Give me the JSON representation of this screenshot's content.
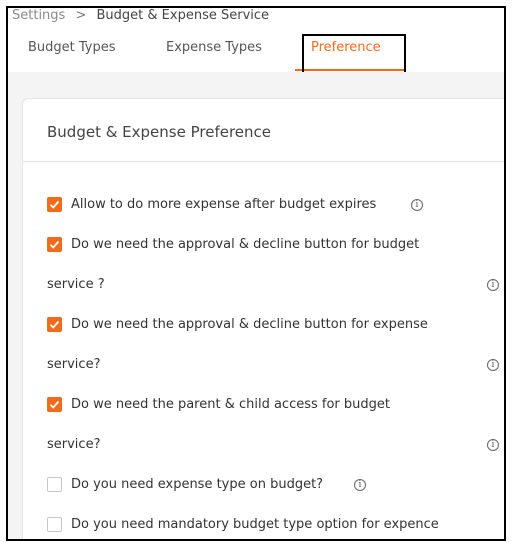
{
  "breadcrumb": {
    "root": "Settings",
    "separator": ">",
    "current": "Budget & Expense Service"
  },
  "tabs": [
    {
      "label": "Budget Types",
      "active": false
    },
    {
      "label": "Expense Types",
      "active": false
    },
    {
      "label": "Preference",
      "active": true
    }
  ],
  "card": {
    "title": "Budget & Expense Preference"
  },
  "options": [
    {
      "line1": "Allow to do more expense after budget expires",
      "line2": "",
      "checked": true
    },
    {
      "line1": "Do we need the approval & decline button for budget",
      "line2": "service ?",
      "checked": true
    },
    {
      "line1": "Do we need the approval & decline button for expense",
      "line2": "service?",
      "checked": true
    },
    {
      "line1": "Do we need the parent & child access for budget",
      "line2": "service?",
      "checked": true
    },
    {
      "line1": "Do you need expense type on budget?",
      "line2": "",
      "checked": false
    },
    {
      "line1": "Do you need mandatory budget type option for expence",
      "line2": "",
      "checked": false
    }
  ],
  "colors": {
    "accent": "#f26a1b",
    "background": "#f4f4f4"
  },
  "icons": {
    "info": "info-circle-icon",
    "check": "check-icon"
  }
}
